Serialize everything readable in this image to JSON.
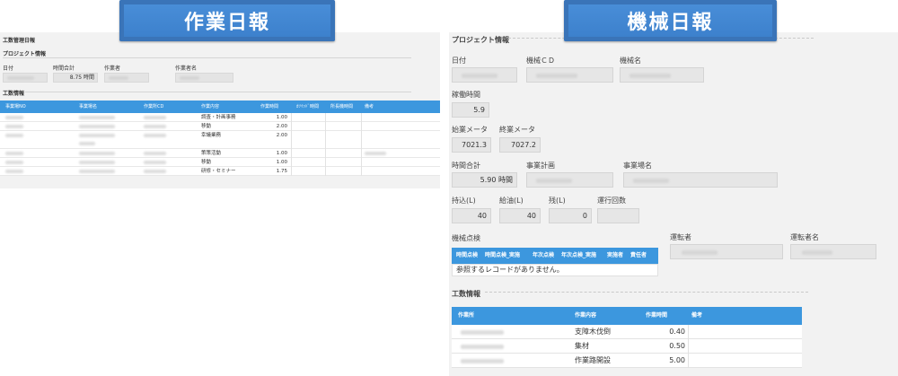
{
  "banners": {
    "left": "作業日報",
    "right": "機械日報"
  },
  "left": {
    "title": "工数管理日報",
    "section_project": "プロジェクト情報",
    "labels": {
      "date": "日付",
      "total_time": "時間合計",
      "worker": "作業者",
      "worker_name": "作業者名"
    },
    "total_time_value": "8.75 時間",
    "section_work": "工数情報",
    "table": {
      "headers": [
        "事業場NO",
        "事業場名",
        "作業所CD",
        "作業内容",
        "作業時間",
        "ｶｿｲｯﾄﾞ時間",
        "所長機時間",
        "備考"
      ],
      "rows": [
        {
          "content": "調査・計画事務",
          "hours": "1.00"
        },
        {
          "content": "移動",
          "hours": "2.00"
        },
        {
          "content": "幸議業務",
          "hours": "2.00"
        },
        {
          "content": "策策活動",
          "hours": "1.00"
        },
        {
          "content": "移動",
          "hours": "1.00"
        },
        {
          "content": "研修・セミナー",
          "hours": "1.75"
        }
      ]
    }
  },
  "right": {
    "section_project": "プロジェクト情報",
    "labels": {
      "date": "日付",
      "machine_cd": "機械ＣＤ",
      "machine_name": "機械名",
      "operating_time": "稼働時間",
      "start_meter": "始業メータ",
      "end_meter": "終業メータ",
      "total_time": "時間合計",
      "business_plan": "事業計画",
      "business_site": "事業場名",
      "loaded": "持込(L)",
      "refuel": "給油(L)",
      "remaining": "残(L)",
      "operation_count": "運行回数",
      "machine_inspection": "機械点検",
      "driver": "運転者",
      "driver_name": "運転者名",
      "section_work": "工数情報"
    },
    "values": {
      "operating_time": "5.9",
      "start_meter": "7021.3",
      "end_meter": "7027.2",
      "total_time": "5.90 時間",
      "loaded": "40",
      "refuel": "40",
      "remaining": "0"
    },
    "inspection_table": {
      "headers": [
        "時間点検",
        "時間点検_実施",
        "年次点検",
        "年次点検_実施",
        "実施者",
        "責任者"
      ],
      "empty_message": "参照するレコードがありません。"
    },
    "work_table": {
      "headers": [
        "作業所",
        "作業内容",
        "作業時間",
        "備考"
      ],
      "rows": [
        {
          "content": "支障木伐倒",
          "hours": "0.40"
        },
        {
          "content": "集材",
          "hours": "0.50"
        },
        {
          "content": "作業路開設",
          "hours": "5.00"
        }
      ]
    }
  }
}
